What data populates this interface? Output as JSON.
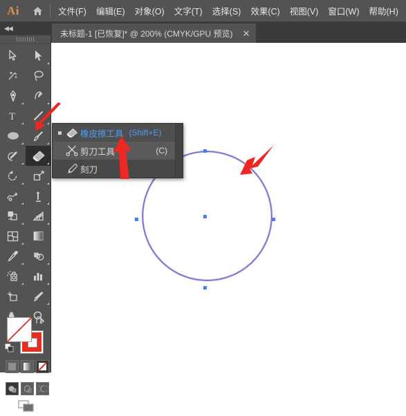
{
  "app": {
    "logo_text": "Ai",
    "home_icon": "home-icon"
  },
  "menubar": {
    "items": [
      {
        "label": "文件(F)"
      },
      {
        "label": "编辑(E)"
      },
      {
        "label": "对象(O)"
      },
      {
        "label": "文字(T)"
      },
      {
        "label": "选择(S)"
      },
      {
        "label": "效果(C)"
      },
      {
        "label": "视图(V)"
      },
      {
        "label": "窗口(W)"
      },
      {
        "label": "帮助(H)"
      }
    ]
  },
  "tabbar": {
    "document_title": "未标题-1 [已恢复]* @ 200% (CMYK/GPU 预览)",
    "close_label": "✕",
    "collapse_label": "◀◀"
  },
  "toolbar": {
    "tools": [
      {
        "name": "selection-tool",
        "label": "选择工具"
      },
      {
        "name": "direct-selection-tool",
        "label": "直接选择工具"
      },
      {
        "name": "magic-wand-tool",
        "label": "魔棒工具"
      },
      {
        "name": "lasso-tool",
        "label": "套索工具"
      },
      {
        "name": "pen-tool",
        "label": "钢笔工具"
      },
      {
        "name": "curvature-tool",
        "label": "曲率工具"
      },
      {
        "name": "type-tool",
        "label": "文字工具"
      },
      {
        "name": "line-segment-tool",
        "label": "直线段工具"
      },
      {
        "name": "ellipse-tool",
        "label": "椭圆工具"
      },
      {
        "name": "paintbrush-tool",
        "label": "画笔工具"
      },
      {
        "name": "shaper-pencil-tool",
        "label": "Shaper 工具"
      },
      {
        "name": "eraser-tool",
        "label": "橡皮擦工具"
      },
      {
        "name": "rotate-tool",
        "label": "旋转工具"
      },
      {
        "name": "scale-tool",
        "label": "比例缩放工具"
      },
      {
        "name": "width-tool",
        "label": "宽度工具"
      },
      {
        "name": "free-transform-tool",
        "label": "自由变换工具"
      },
      {
        "name": "shape-builder-tool",
        "label": "形状生成器工具"
      },
      {
        "name": "perspective-grid-tool",
        "label": "透视网格工具"
      },
      {
        "name": "mesh-tool",
        "label": "网格工具"
      },
      {
        "name": "gradient-tool",
        "label": "渐变工具"
      },
      {
        "name": "eyedropper-tool",
        "label": "吸管工具"
      },
      {
        "name": "blend-tool",
        "label": "混合工具"
      },
      {
        "name": "symbol-sprayer-tool",
        "label": "符号喷枪工具"
      },
      {
        "name": "column-graph-tool",
        "label": "柱形图工具"
      },
      {
        "name": "artboard-tool",
        "label": "画板工具"
      },
      {
        "name": "slice-tool",
        "label": "切片工具"
      },
      {
        "name": "hand-tool",
        "label": "抓手工具"
      },
      {
        "name": "zoom-tool",
        "label": "缩放工具"
      }
    ],
    "active_tool": "eraser-tool",
    "swatches": {
      "fill_color": "#ffffff",
      "fill_is_none": true,
      "stroke_color": "#ea2c1f",
      "swap_label": "swap-fill-stroke-icon",
      "default_label": "default-fill-stroke-icon"
    },
    "paint_modes": [
      {
        "name": "color-mode",
        "selected": false
      },
      {
        "name": "gradient-mode",
        "selected": false
      },
      {
        "name": "none-mode",
        "selected": true
      }
    ],
    "draw_modes": [
      {
        "name": "draw-normal",
        "selected": true
      },
      {
        "name": "draw-behind",
        "selected": false
      },
      {
        "name": "draw-inside",
        "selected": false
      }
    ],
    "screen_mode": {
      "name": "change-screen-mode"
    }
  },
  "flyout_menu": {
    "items": [
      {
        "name": "eraser-tool",
        "label": "橡皮擦工具",
        "shortcut": "(Shift+E)",
        "shortcut_position": "inline",
        "selected": true,
        "hovered": false,
        "has_submenu": false,
        "bulleted": true
      },
      {
        "name": "scissors-tool",
        "label": "剪刀工具",
        "shortcut": "(C)",
        "shortcut_position": "right",
        "selected": false,
        "hovered": true,
        "has_submenu": true,
        "bulleted": false
      },
      {
        "name": "knife-tool",
        "label": "刻刀",
        "shortcut": "",
        "shortcut_position": "right",
        "selected": false,
        "hovered": false,
        "has_submenu": false,
        "bulleted": false
      }
    ]
  },
  "canvas": {
    "background_color": "#ffffff",
    "shape": {
      "name": "ellipse-path",
      "type": "circle",
      "stroke_color": "#a1509c",
      "selection_color": "#4a7cf6",
      "anchors": [
        "top",
        "right",
        "bottom",
        "left",
        "center"
      ]
    }
  },
  "annotations": {
    "arrow_color": "#ee2722",
    "arrows": [
      {
        "name": "annotation-arrow-eraser-tool",
        "points_to": "eraser-tool"
      },
      {
        "name": "annotation-arrow-scissors-item",
        "points_to": "scissors-tool"
      },
      {
        "name": "annotation-arrow-circle-path",
        "points_to": "ellipse-path"
      }
    ]
  },
  "colors": {
    "chrome_bg": "#535353",
    "tab_bg": "#3b3b3b",
    "menu_bg": "#484848",
    "accent_blue": "#4f9af5",
    "logo_orange": "#d9905a"
  }
}
